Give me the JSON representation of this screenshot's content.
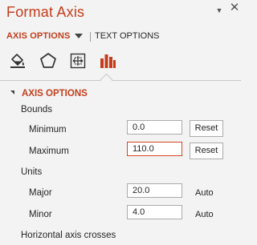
{
  "pane": {
    "title": "Format Axis"
  },
  "window_buttons": {
    "pin_icon": "triangle-down-icon",
    "close_icon": "close-icon",
    "close_glyph": "✕",
    "pin_glyph": "▼"
  },
  "tabs": {
    "axis_options": "AXIS OPTIONS",
    "text_options": "TEXT OPTIONS"
  },
  "icon_tabs": [
    "fill-line-icon",
    "effects-icon",
    "size-properties-icon",
    "axis-options-chart-icon"
  ],
  "section": {
    "title": "AXIS OPTIONS"
  },
  "bounds": {
    "label": "Bounds",
    "minimum": {
      "label": "Minimum",
      "value": "0.0",
      "button": "Reset"
    },
    "maximum": {
      "label": "Maximum",
      "value": "110.0",
      "button": "Reset"
    }
  },
  "units": {
    "label": "Units",
    "major": {
      "label": "Major",
      "value": "20.0",
      "mode": "Auto"
    },
    "minor": {
      "label": "Minor",
      "value": "4.0",
      "mode": "Auto"
    }
  },
  "horizontal_axis_crosses": {
    "label": "Horizontal axis crosses"
  },
  "colors": {
    "accent": "#c43e1c",
    "focus_border": "#d24726",
    "background": "#f3f3f3"
  }
}
